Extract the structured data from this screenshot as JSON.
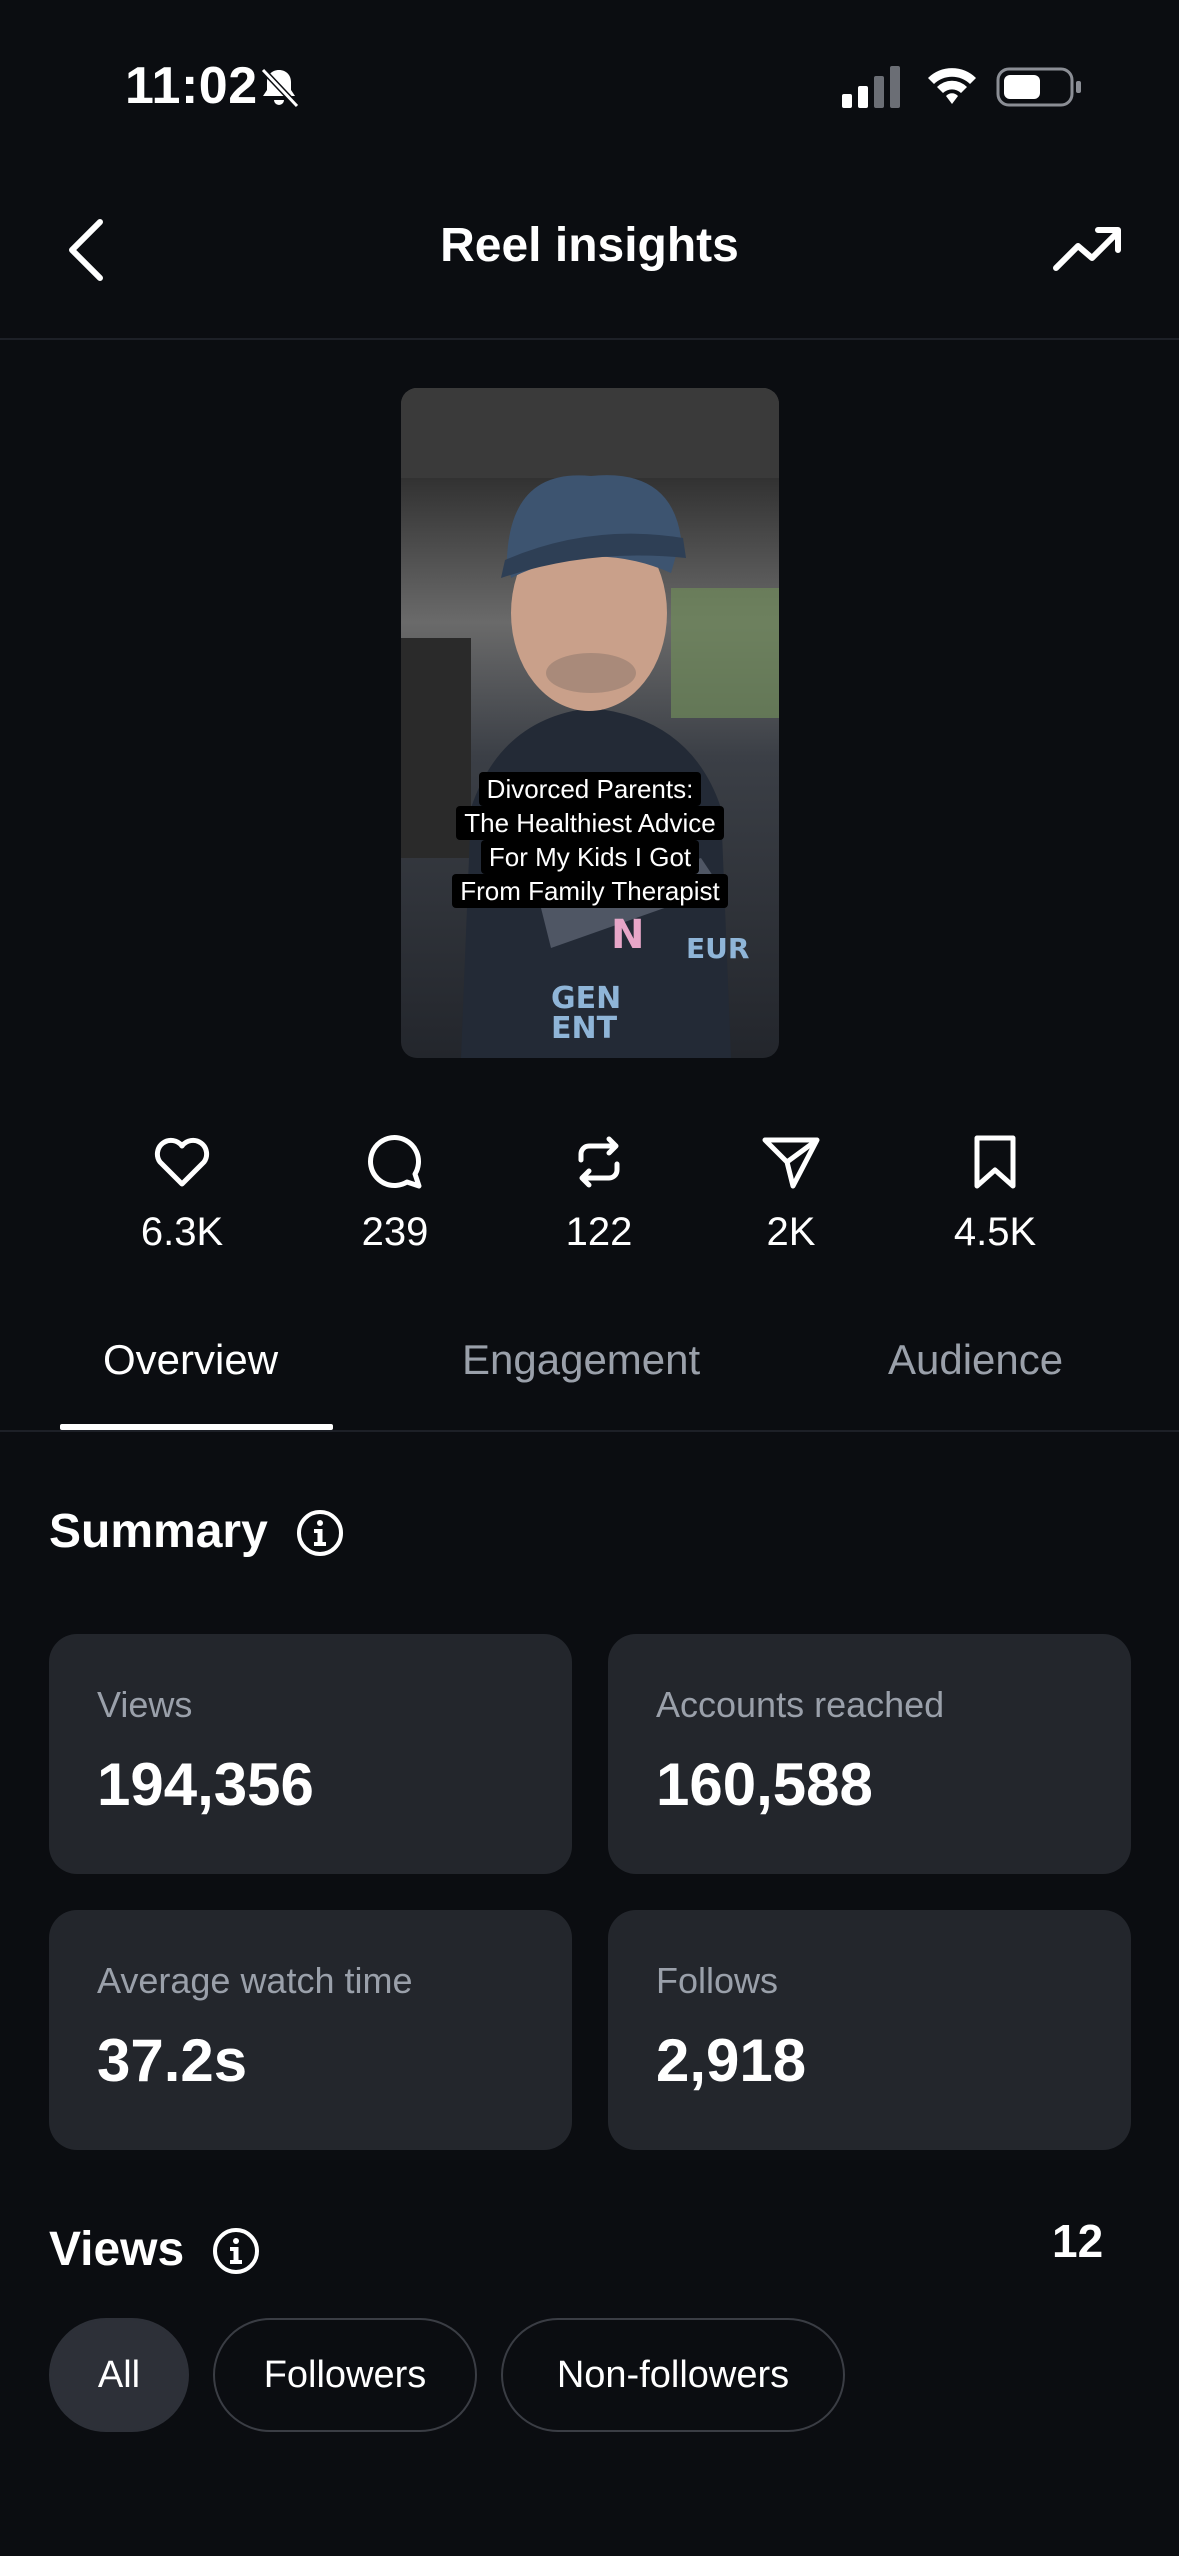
{
  "status_bar": {
    "time": "11:02"
  },
  "nav": {
    "title": "Reel insights"
  },
  "reel": {
    "caption_lines": [
      "Divorced Parents:",
      "The Healthiest Advice",
      "For My Kids I Got",
      "From Family Therapist"
    ]
  },
  "stats": [
    {
      "icon": "heart-icon",
      "value": "6.3K"
    },
    {
      "icon": "comment-icon",
      "value": "239"
    },
    {
      "icon": "repost-icon",
      "value": "122"
    },
    {
      "icon": "share-icon",
      "value": "2K"
    },
    {
      "icon": "bookmark-icon",
      "value": "4.5K"
    }
  ],
  "tabs": [
    {
      "label": "Overview",
      "active": true
    },
    {
      "label": "Engagement",
      "active": false
    },
    {
      "label": "Audience",
      "active": false
    }
  ],
  "summary": {
    "title": "Summary",
    "cards": [
      {
        "label": "Views",
        "value": "194,356"
      },
      {
        "label": "Accounts reached",
        "value": "160,588"
      },
      {
        "label": "Average watch time",
        "value": "37.2s"
      },
      {
        "label": "Follows",
        "value": "2,918"
      }
    ]
  },
  "views_section": {
    "title": "Views",
    "counter": "12",
    "filters": [
      {
        "label": "All",
        "selected": true
      },
      {
        "label": "Followers",
        "selected": false
      },
      {
        "label": "Non-followers",
        "selected": false
      }
    ]
  }
}
